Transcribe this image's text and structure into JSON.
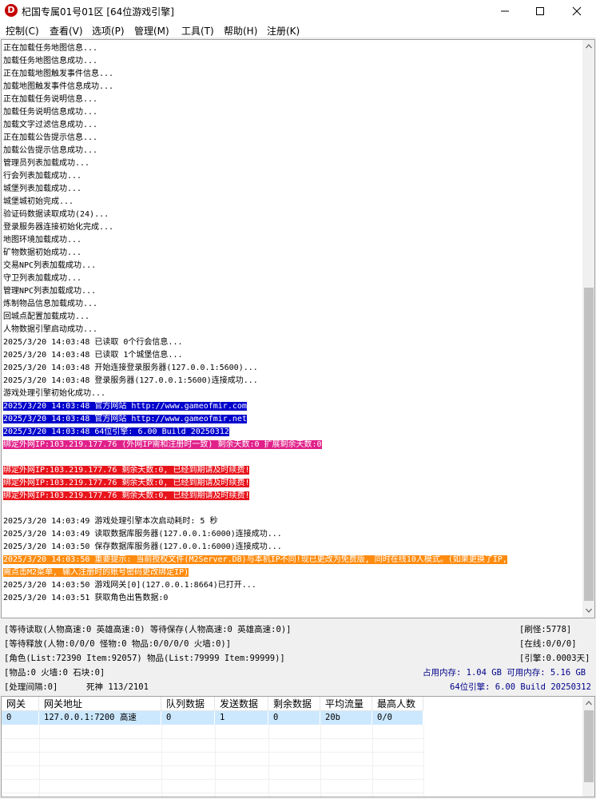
{
  "window": {
    "title": "杞国专属01号01区 [64位游戏引擎]",
    "app_icon_letter": "D"
  },
  "menu": [
    "控制(C)",
    "查看(V)",
    "选项(P)",
    "管理(M)",
    "工具(T)",
    "帮助(H)",
    "注册(K)"
  ],
  "log_lines": [
    {
      "text": "正在加载任务地图信息...",
      "style": ""
    },
    {
      "text": "加载任务地图信息成功...",
      "style": ""
    },
    {
      "text": "正在加载地图触发事件信息...",
      "style": ""
    },
    {
      "text": "加载地图触发事件信息成功...",
      "style": ""
    },
    {
      "text": "正在加载任务说明信息...",
      "style": ""
    },
    {
      "text": "加载任务说明信息成功...",
      "style": ""
    },
    {
      "text": "加载文字过滤信息成功...",
      "style": ""
    },
    {
      "text": "正在加载公告提示信息...",
      "style": ""
    },
    {
      "text": "加载公告提示信息成功...",
      "style": ""
    },
    {
      "text": "管理员列表加载成功...",
      "style": ""
    },
    {
      "text": "行会列表加载成功...",
      "style": ""
    },
    {
      "text": "城堡列表加载成功...",
      "style": ""
    },
    {
      "text": "城堡城初始完成...",
      "style": ""
    },
    {
      "text": "验证码数据读取成功(24)...",
      "style": ""
    },
    {
      "text": "登录服务器连接初始化完成...",
      "style": ""
    },
    {
      "text": "地图环境加载成功...",
      "style": ""
    },
    {
      "text": "矿物数据初始成功...",
      "style": ""
    },
    {
      "text": "交易NPC列表加载成功...",
      "style": ""
    },
    {
      "text": "守卫列表加载成功...",
      "style": ""
    },
    {
      "text": "管理NPC列表加载成功...",
      "style": ""
    },
    {
      "text": "炼制物品信息加载成功...",
      "style": ""
    },
    {
      "text": "回城点配置加载成功...",
      "style": ""
    },
    {
      "text": "人物数据引擎启动成功...",
      "style": ""
    },
    {
      "text": "2025/3/20 14:03:48 已读取 0个行会信息...",
      "style": ""
    },
    {
      "text": "2025/3/20 14:03:48 已读取 1个城堡信息...",
      "style": ""
    },
    {
      "text": "2025/3/20 14:03:48 开始连接登录服务器(127.0.0.1:5600)...",
      "style": ""
    },
    {
      "text": "2025/3/20 14:03:48 登录服务器(127.0.0.1:5600)连接成功...",
      "style": ""
    },
    {
      "text": "游戏处理引擎初始化成功...",
      "style": ""
    },
    {
      "text": "2025/3/20 14:03:48 官方网站 http://www.gameofmir.com",
      "style": "hl-blue"
    },
    {
      "text": "2025/3/20 14:03:48 官方网站 http://www.gameofmir.net",
      "style": "hl-blue"
    },
    {
      "text": "2025/3/20 14:03:48 64位引擎: 6.00 Build 20250312",
      "style": "hl-blue"
    },
    {
      "text": "绑定外网IP:103.219.177.76 (外网IP需和注册时一致) 剩余天数:0 扩展剩余天数:0",
      "style": "hl-pink"
    },
    {
      "text": "",
      "style": ""
    },
    {
      "text": "绑定外网IP:103.219.177.76 剩余天数:0, 已经到期请及时续费!",
      "style": "hl-red"
    },
    {
      "text": "绑定外网IP:103.219.177.76 剩余天数:0, 已经到期请及时续费!",
      "style": "hl-red"
    },
    {
      "text": "绑定外网IP:103.219.177.76 剩余天数:0, 已经到期请及时续费!",
      "style": "hl-red"
    },
    {
      "text": "",
      "style": ""
    },
    {
      "text": "2025/3/20 14:03:49 游戏处理引擎本次启动耗时: 5 秒",
      "style": ""
    },
    {
      "text": "2025/3/20 14:03:49 读取数据库服务器(127.0.0.1:6000)连接成功...",
      "style": ""
    },
    {
      "text": "2025/3/20 14:03:50 保存数据库服务器(127.0.0.1:6000)连接成功...",
      "style": ""
    },
    {
      "text": "2025/3/20 14:03:50 重要提示: 当前授权文件(M2Server.DB)与本机IP不同!现已更改为免费版, 同时在线10人模式。(如果更换了IP,",
      "style": "hl-orange"
    },
    {
      "text": "需点击M2菜单, 输入注册时的账号密码更改绑定IP)",
      "style": "hl-orange"
    },
    {
      "text": "2025/3/20 14:03:50 游戏网关[0](127.0.0.1:8664)已打开...",
      "style": ""
    },
    {
      "text": "2025/3/20 14:03:51 获取角色出售数据:0",
      "style": ""
    }
  ],
  "status": {
    "line1": "[等待读取(人物高速:0 英雄高速:0) 等待保存(人物高速:0 英雄高速:0)]",
    "line2": "[等待释放(人物:0/0/0 怪物:0 物品:0/0/0/0 火墙:0)]",
    "line3": "[角色(List:72390 Item:92057) 物品(List:79999 Item:99999)]",
    "line4": "[物品:0 火墙:0 石块:0]",
    "line5a": "[处理间隔:0]",
    "line5b": "死神 113/2101",
    "right1": "[刷怪:5778]",
    "right2": "[在线:0/0/0]",
    "right3": "[引擎:0.0003天]",
    "memory": "占用内存: 1.04 GB 可用内存: 5.16 GB",
    "engine": "64位引擎: 6.00 Build 20250312"
  },
  "gateway_table": {
    "columns": [
      "网关",
      "网关地址",
      "队列数据",
      "发送数据",
      "剩余数据",
      "平均流量",
      "最高人数"
    ],
    "rows": [
      [
        "0",
        "127.0.0.1:7200 高速",
        "0",
        "1",
        "0",
        "20b",
        "0/0"
      ]
    ]
  }
}
